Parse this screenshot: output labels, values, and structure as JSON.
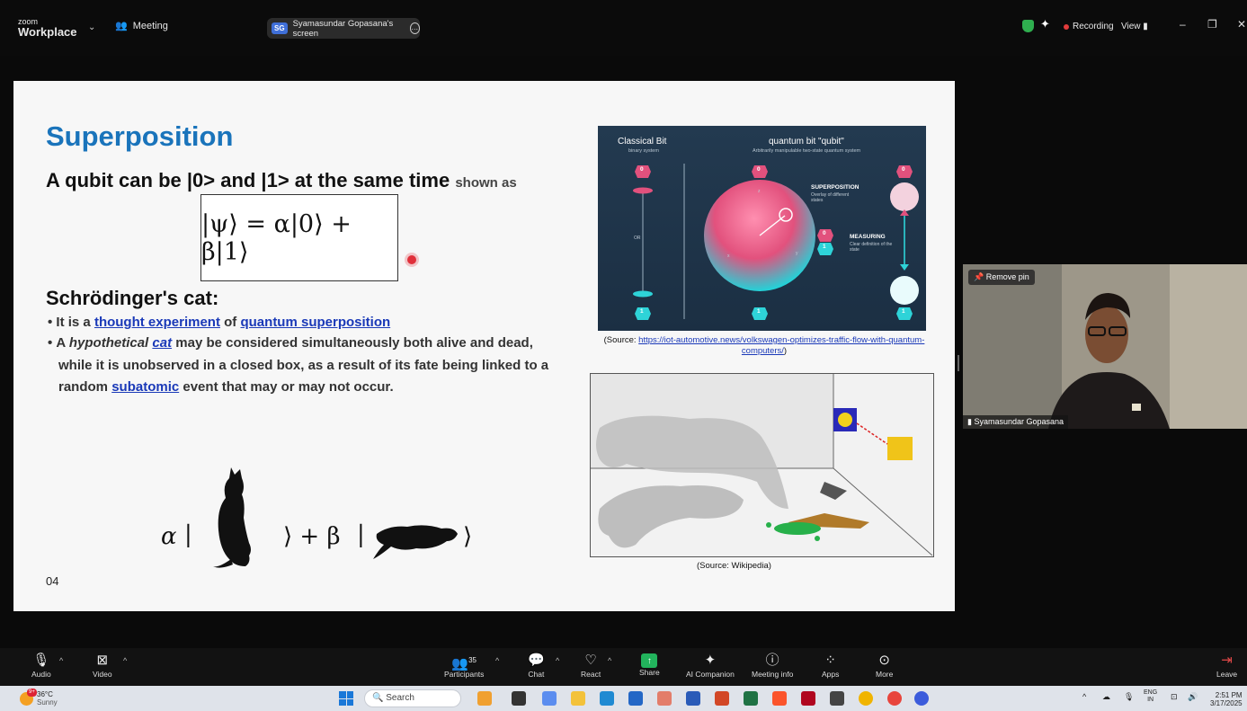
{
  "app": {
    "brand_top": "zoom",
    "brand_name": "Workplace",
    "meeting_label": "Meeting"
  },
  "share_pill": {
    "initials": "SG",
    "label": "Syamasundar Gopasana's screen"
  },
  "top_right": {
    "recording_label": "Recording",
    "view_label": "View"
  },
  "slide": {
    "title": "Superposition",
    "line1_main": "A qubit can be |0> and |1> at the same time",
    "line1_small": "shown as",
    "equation": "|ψ⟩ = α|0⟩ + β|1⟩",
    "cat_heading": "Schrödinger's cat:",
    "bullet1": {
      "prefix": "It is a",
      "link1": "thought experiment",
      "mid": "of",
      "link2": "quantum superposition"
    },
    "bullet2": {
      "prefix": "A",
      "italic": "hypothetical",
      "link_cat": "cat",
      "line1_rest": "may be considered simultaneously both alive and dead,",
      "line2": "while it is unobserved in a closed box, as a result of its fate being linked to a",
      "line3_pre": "random",
      "link_sub": "subatomic",
      "line3_post": "event that may or may not occur."
    },
    "cat_eq": {
      "alpha": "α",
      "bar1": "|",
      "plus_beta": "⟩ + β",
      "bar2": "|",
      "end": "⟩"
    },
    "page_number": "04",
    "qubit_image": {
      "classical_label": "Classical Bit",
      "classical_sub": "binary system",
      "quantum_label": "quantum bit \"qubit\"",
      "quantum_sub": "Arbitrarily manipulable two-state quantum system",
      "superposition": "SUPERPOSITION",
      "superposition_sub": "Overlay of different states",
      "measuring": "MEASURING",
      "measuring_sub": "Clear definition of the state",
      "zero": "0",
      "one": "1",
      "or": "OR",
      "axis_x": "x",
      "axis_y": "y",
      "axis_z": "z"
    },
    "source1_prefix": "(Source:",
    "source1_link": "https://iot-automotive.news/volkswagen-optimizes-traffic-flow-with-quantum-computers/",
    "source1_suffix": ")",
    "source2": "(Source: Wikipedia)"
  },
  "video": {
    "remove_pin": "Remove pin",
    "participant_name": "Syamasundar Gopasana"
  },
  "toolbar": {
    "audio": "Audio",
    "video": "Video",
    "participants": "Participants",
    "participants_count": "35",
    "chat": "Chat",
    "react": "React",
    "share": "Share",
    "ai_companion": "AI Companion",
    "meeting_info": "Meeting info",
    "apps": "Apps",
    "more": "More",
    "leave": "Leave"
  },
  "taskbar": {
    "weather_badge": "9+",
    "temp": "36°C",
    "condition": "Sunny",
    "search": "Search",
    "lang": "ENG",
    "region": "IN",
    "time": "2:51 PM",
    "date": "3/17/2025"
  },
  "colors": {
    "title_blue": "#1a74bb",
    "link_blue": "#1a39b8",
    "share_green": "#22b35c",
    "record_red": "#e23b3b"
  }
}
